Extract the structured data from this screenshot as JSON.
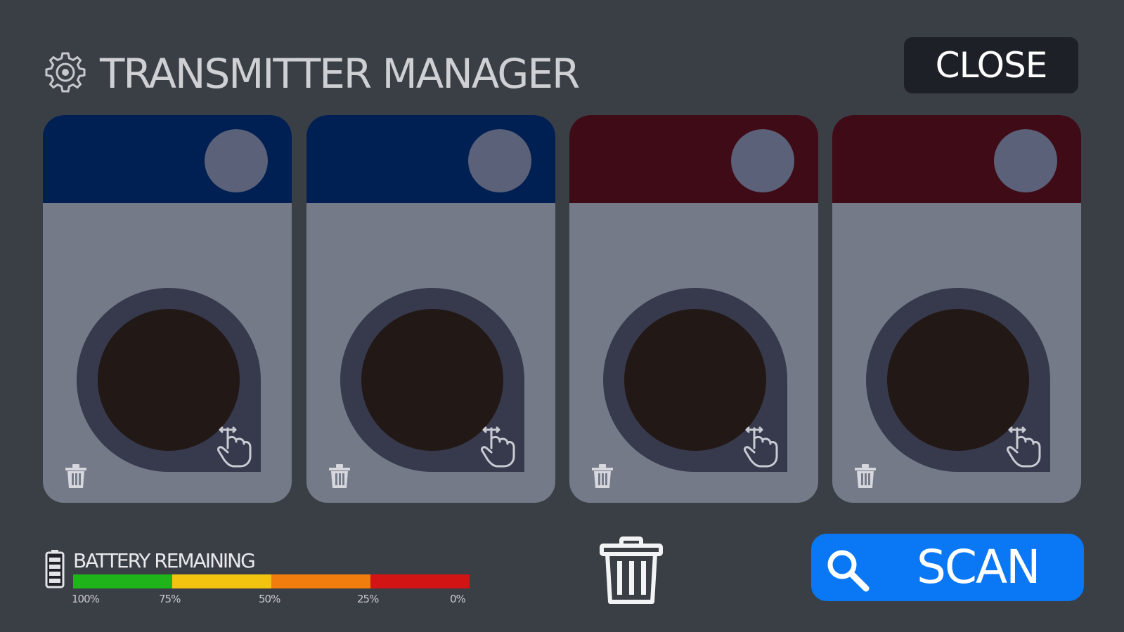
{
  "header": {
    "title": "TRANSMITTER MANAGER",
    "icon": "gear-icon",
    "close_label": "CLOSE"
  },
  "transmitters": [
    {
      "slot_color": "#001f52",
      "slot_team": "blue"
    },
    {
      "slot_color": "#001f52",
      "slot_team": "blue"
    },
    {
      "slot_color": "#3f0b17",
      "slot_team": "red"
    },
    {
      "slot_color": "#3f0b17",
      "slot_team": "red"
    }
  ],
  "battery": {
    "label": "BATTERY REMAINING",
    "ticks": [
      "100%",
      "75%",
      "50%",
      "25%",
      "0%"
    ],
    "segment_colors": [
      "#1fb41a",
      "#f2c40f",
      "#f07d0e",
      "#d21414"
    ]
  },
  "actions": {
    "delete_all_icon": "trash-icon",
    "scan_label": "SCAN",
    "scan_icon": "search-icon"
  },
  "colors": {
    "background": "#3a3e45",
    "card": "#757a89",
    "accent": "#0a78f5"
  }
}
